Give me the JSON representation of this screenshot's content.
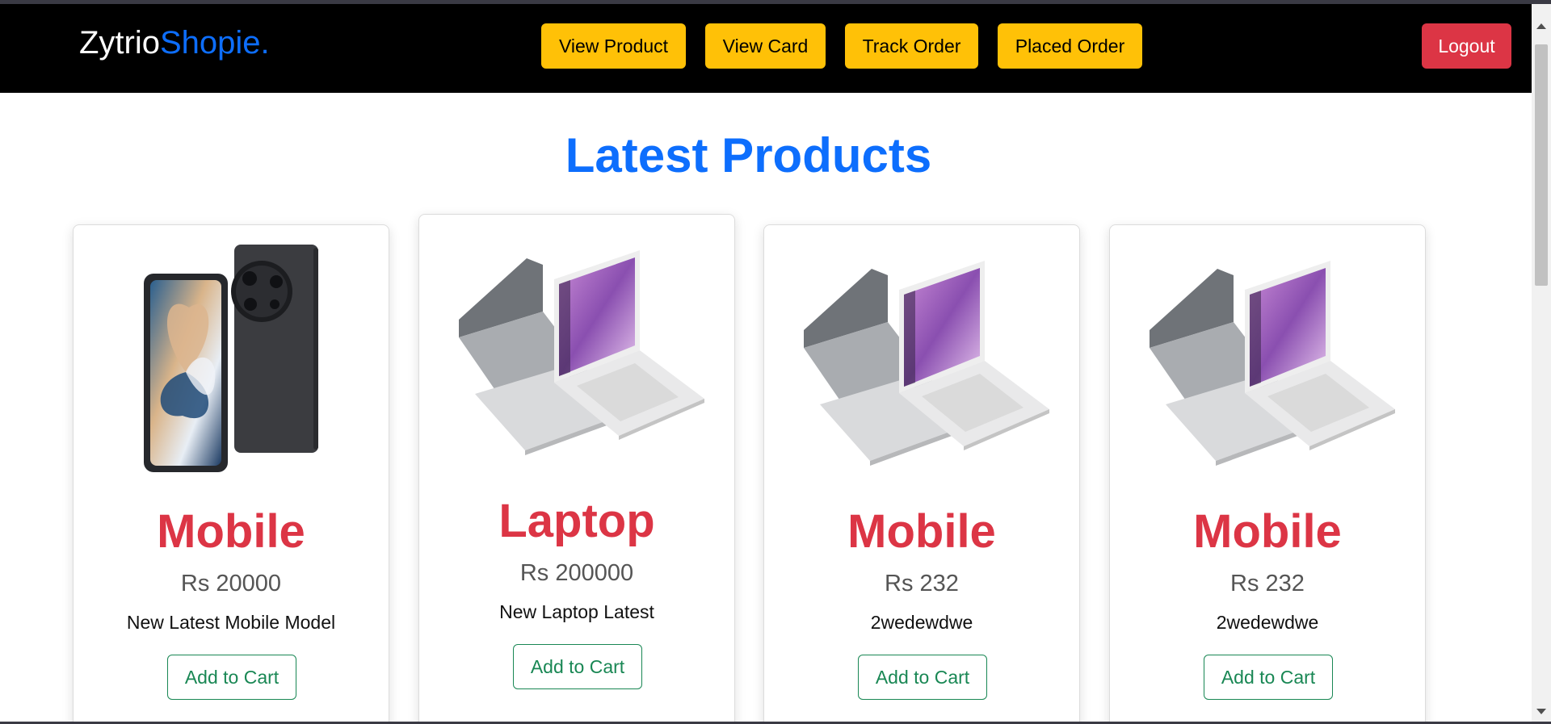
{
  "brand": {
    "first": "Zytrio",
    "second": "Shopie."
  },
  "nav": {
    "view_product": "View Product",
    "view_card": "View Card",
    "track_order": "Track Order",
    "placed_order": "Placed Order",
    "logout": "Logout"
  },
  "main": {
    "title": "Latest Products"
  },
  "products": [
    {
      "name": "Mobile",
      "price": "Rs 20000",
      "description": "New Latest Mobile Model",
      "button": "Add to Cart",
      "image": "phone-image"
    },
    {
      "name": "Laptop",
      "price": "Rs 200000",
      "description": "New Laptop Latest",
      "button": "Add to Cart",
      "image": "laptop-image"
    },
    {
      "name": "Mobile",
      "price": "Rs 232",
      "description": "2wedewdwe",
      "button": "Add to Cart",
      "image": "laptop-image"
    },
    {
      "name": "Mobile",
      "price": "Rs 232",
      "description": "2wedewdwe",
      "button": "Add to Cart",
      "image": "laptop-image"
    }
  ],
  "colors": {
    "navbar": "#000000",
    "brand_accent": "#0d6efd",
    "nav_button": "#ffc107",
    "logout_button": "#dc3545",
    "title": "#0d6efd",
    "product_name": "#dc3545",
    "add_to_cart": "#198754"
  }
}
